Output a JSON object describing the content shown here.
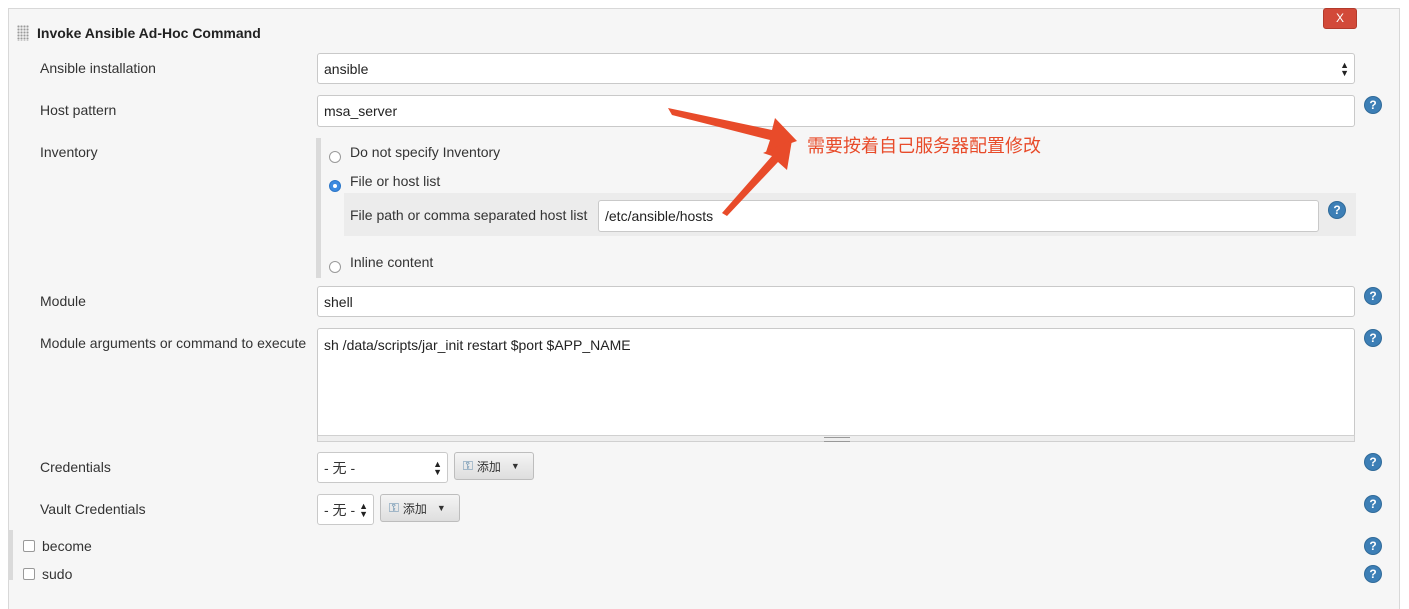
{
  "section": {
    "title": "Invoke Ansible Ad-Hoc Command",
    "delete_label": "X"
  },
  "fields": {
    "installation": {
      "label": "Ansible installation",
      "value": "ansible"
    },
    "host_pattern": {
      "label": "Host pattern",
      "value": "msa_server"
    },
    "inventory": {
      "label": "Inventory",
      "options": [
        "Do not specify Inventory",
        "File or host list",
        "Inline content"
      ],
      "selected": "File or host list",
      "file_label": "File path or comma separated host list",
      "file_value": "/etc/ansible/hosts"
    },
    "module": {
      "label": "Module",
      "value": "shell"
    },
    "module_args": {
      "label": "Module arguments or command to execute",
      "value": "sh /data/scripts/jar_init restart $port $APP_NAME"
    },
    "credentials": {
      "label": "Credentials",
      "value": "- 无 -",
      "add_label": "添加"
    },
    "vault_credentials": {
      "label": "Vault Credentials",
      "value": "- 无 -",
      "add_label": "添加"
    },
    "become": {
      "label": "become",
      "checked": false
    },
    "sudo": {
      "label": "sudo",
      "checked": false
    }
  },
  "annotation": {
    "text": "需要按着自己服务器配置修改",
    "color": "#e84b2a"
  },
  "icons": {
    "help": "help-icon",
    "key": "key-icon",
    "grip": "drag-handle-icon"
  },
  "colors": {
    "help_icon": "#3d7fb6",
    "delete_button": "#d24939",
    "radio_selected": "#3c8ae0"
  }
}
